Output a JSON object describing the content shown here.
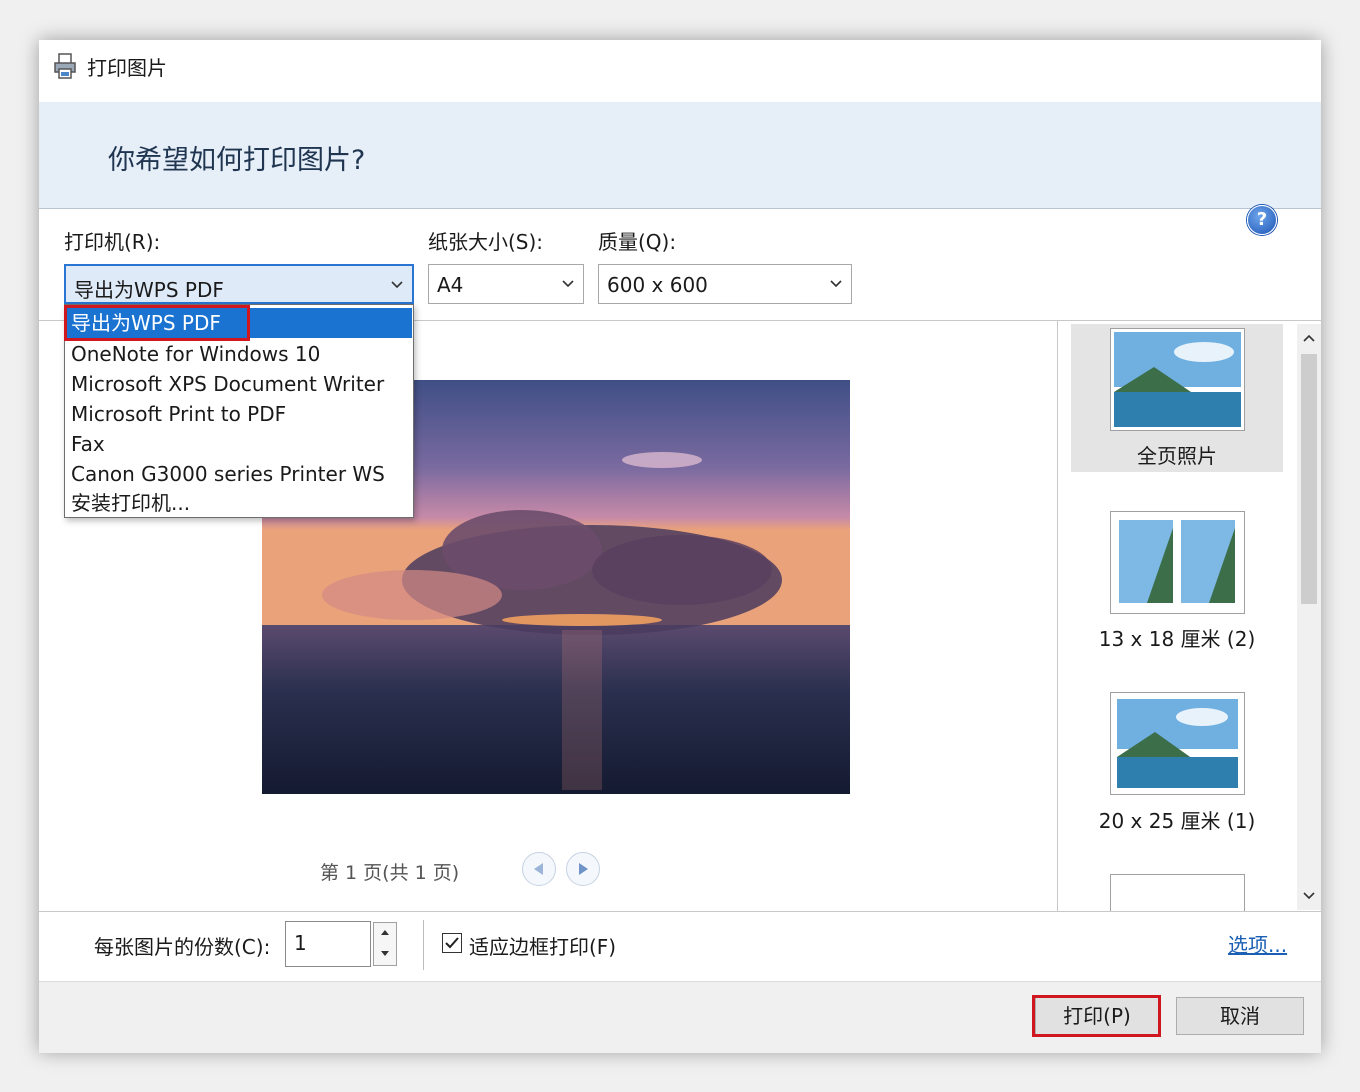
{
  "window": {
    "title": "打印图片"
  },
  "header": {
    "question": "你希望如何打印图片?"
  },
  "settings": {
    "printer_label": "打印机(R):",
    "printer_value": "导出为WPS PDF",
    "paper_label": "纸张大小(S):",
    "paper_value": "A4",
    "quality_label": "质量(Q):",
    "quality_value": "600 x 600",
    "help": "?"
  },
  "printer_dropdown": {
    "options": [
      "导出为WPS PDF",
      "OneNote for Windows 10",
      "Microsoft XPS Document Writer",
      "Microsoft Print to PDF",
      "Fax",
      "Canon G3000 series Printer WS",
      "安装打印机..."
    ],
    "selected_index": 0
  },
  "preview": {
    "page_info": "第 1 页(共 1 页)"
  },
  "layouts": [
    {
      "label": "全页照片",
      "selected": true
    },
    {
      "label": "13 x 18 厘米 (2)",
      "selected": false
    },
    {
      "label": "20 x 25 厘米 (1)",
      "selected": false
    }
  ],
  "bottom": {
    "copies_label": "每张图片的份数(C):",
    "copies_value": "1",
    "fit_label": "适应边框打印(F)",
    "fit_checked": true,
    "options_link": "选项..."
  },
  "buttons": {
    "print": "打印(P)",
    "cancel": "取消"
  },
  "colors": {
    "highlight_red": "#d0161e",
    "selection_blue": "#1a73d1",
    "header_bg": "#e6eef8"
  }
}
